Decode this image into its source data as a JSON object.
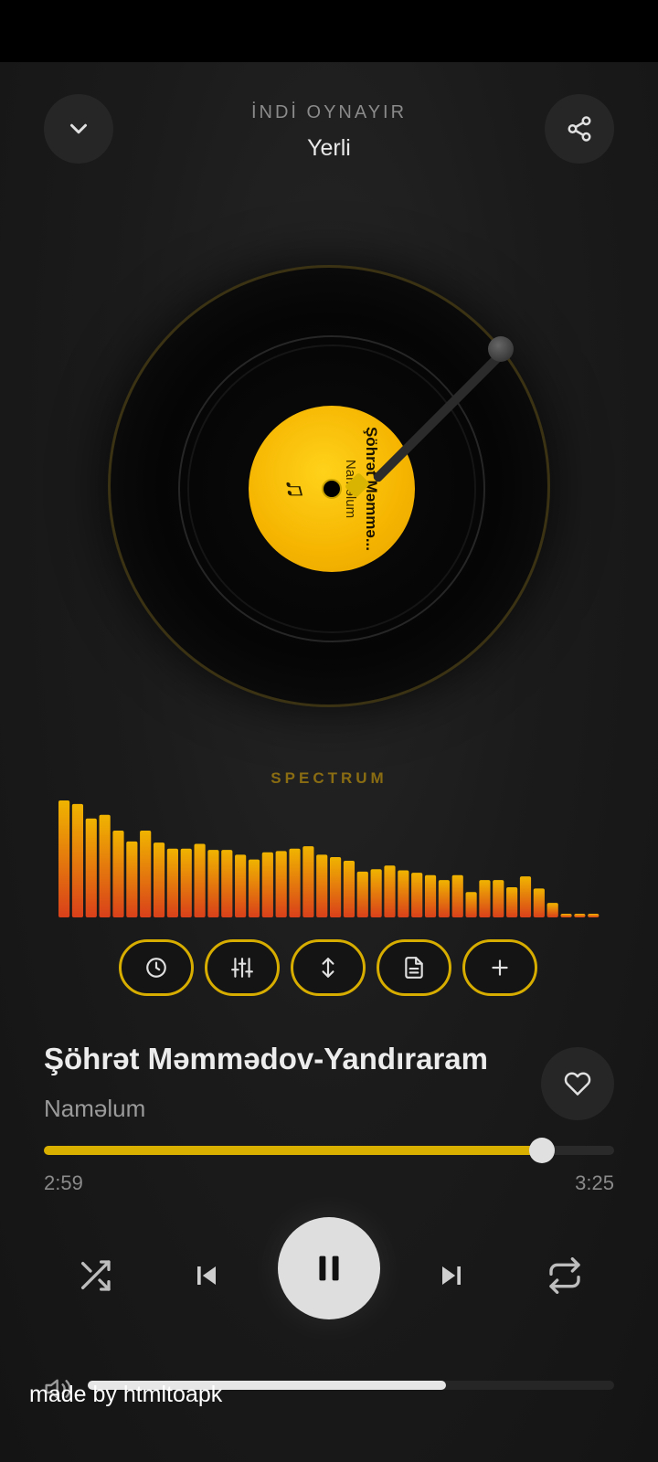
{
  "header": {
    "now_playing_label": "İNDİ OYNAYIR",
    "playlist_name": "Yerli"
  },
  "vinyl": {
    "label_title": "Şöhrət Məmmə...",
    "label_artist": "Naməlum",
    "label_icon": "music-note-icon"
  },
  "spectrum": {
    "title": "SPECTRUM",
    "levels": [
      0.97,
      0.94,
      0.82,
      0.85,
      0.72,
      0.63,
      0.72,
      0.62,
      0.57,
      0.57,
      0.61,
      0.56,
      0.56,
      0.52,
      0.48,
      0.54,
      0.55,
      0.57,
      0.59,
      0.52,
      0.5,
      0.47,
      0.38,
      0.4,
      0.43,
      0.39,
      0.37,
      0.35,
      0.31,
      0.35,
      0.21,
      0.31,
      0.31,
      0.25,
      0.34,
      0.24,
      0.12,
      0.03,
      0.03,
      0.03
    ]
  },
  "tools": [
    {
      "name": "sleep-timer-button",
      "icon": "clock-icon"
    },
    {
      "name": "equalizer-button",
      "icon": "sliders-icon"
    },
    {
      "name": "sort-button",
      "icon": "arrows-up-down-icon"
    },
    {
      "name": "lyrics-button",
      "icon": "document-icon"
    },
    {
      "name": "add-to-playlist-button",
      "icon": "plus-icon"
    }
  ],
  "track": {
    "title": "Şöhrət Məmmədov-Yandıraram",
    "artist": "Naməlum",
    "elapsed": "2:59",
    "duration": "3:25",
    "progress": 0.874
  },
  "volume": {
    "level": 0.68
  },
  "watermark": "made by htmltoapk",
  "colors": {
    "accent": "#d9b000",
    "bar_top": "#f0b400",
    "bar_bottom": "#d9401a"
  }
}
